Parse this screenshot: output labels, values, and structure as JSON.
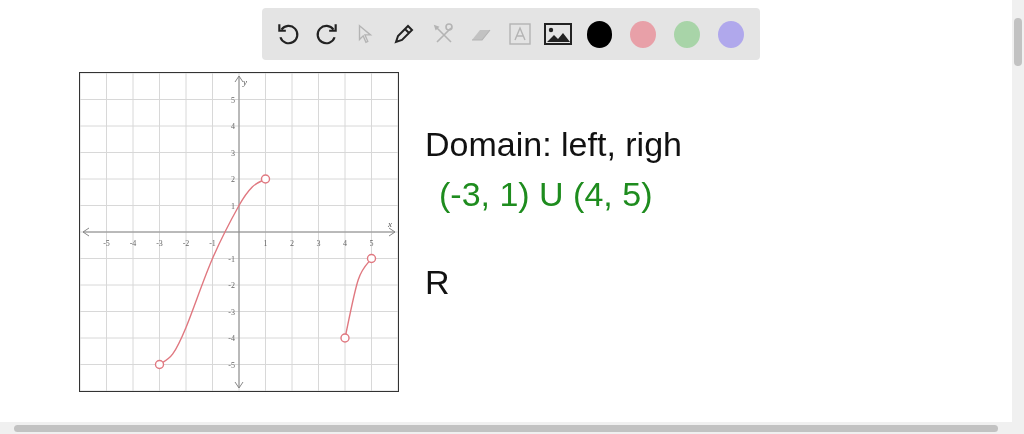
{
  "toolbar": {
    "tools": [
      {
        "kind": "undo",
        "disabled": false
      },
      {
        "kind": "redo",
        "disabled": false
      },
      {
        "kind": "pointer",
        "disabled": true
      },
      {
        "kind": "pen",
        "disabled": false
      },
      {
        "kind": "tools",
        "disabled": true
      },
      {
        "kind": "eraser",
        "disabled": true
      },
      {
        "kind": "text",
        "disabled": true
      },
      {
        "kind": "image",
        "disabled": false
      }
    ],
    "swatches": [
      {
        "color": "#000000"
      },
      {
        "color": "#e8a0a8"
      },
      {
        "color": "#a8d4a8"
      },
      {
        "color": "#b0a8ec"
      }
    ]
  },
  "graph": {
    "chart_data": {
      "type": "line",
      "xlabel": "x",
      "ylabel": "y",
      "x": [
        -3,
        -2.5,
        -2,
        -1,
        0,
        0.5,
        1,
        4,
        4.5,
        5
      ],
      "series": [
        {
          "color": "#e07880",
          "values": [
            -5,
            -4.6,
            -3.6,
            -1,
            1,
            1.7,
            2,
            null,
            null,
            null
          ]
        },
        {
          "color": "#e07880",
          "values": [
            null,
            null,
            null,
            null,
            null,
            null,
            null,
            -4,
            -1.8,
            -1
          ]
        }
      ],
      "grid": true,
      "xlim": [
        -6,
        6
      ],
      "ylim": [
        -6,
        6
      ],
      "xticks": [
        -5,
        -4,
        -3,
        -2,
        -1,
        1,
        2,
        3,
        4,
        5
      ],
      "yticks": [
        -5,
        -4,
        -3,
        -2,
        -1,
        1,
        2,
        3,
        4,
        5
      ]
    }
  },
  "notes": [
    {
      "text": "Domain: left, righ",
      "color": "#111111"
    },
    {
      "text": "(-3, 1) U (4, 5)",
      "color": "#1e8c1e"
    },
    {
      "text": "R",
      "color": "#111111"
    }
  ]
}
